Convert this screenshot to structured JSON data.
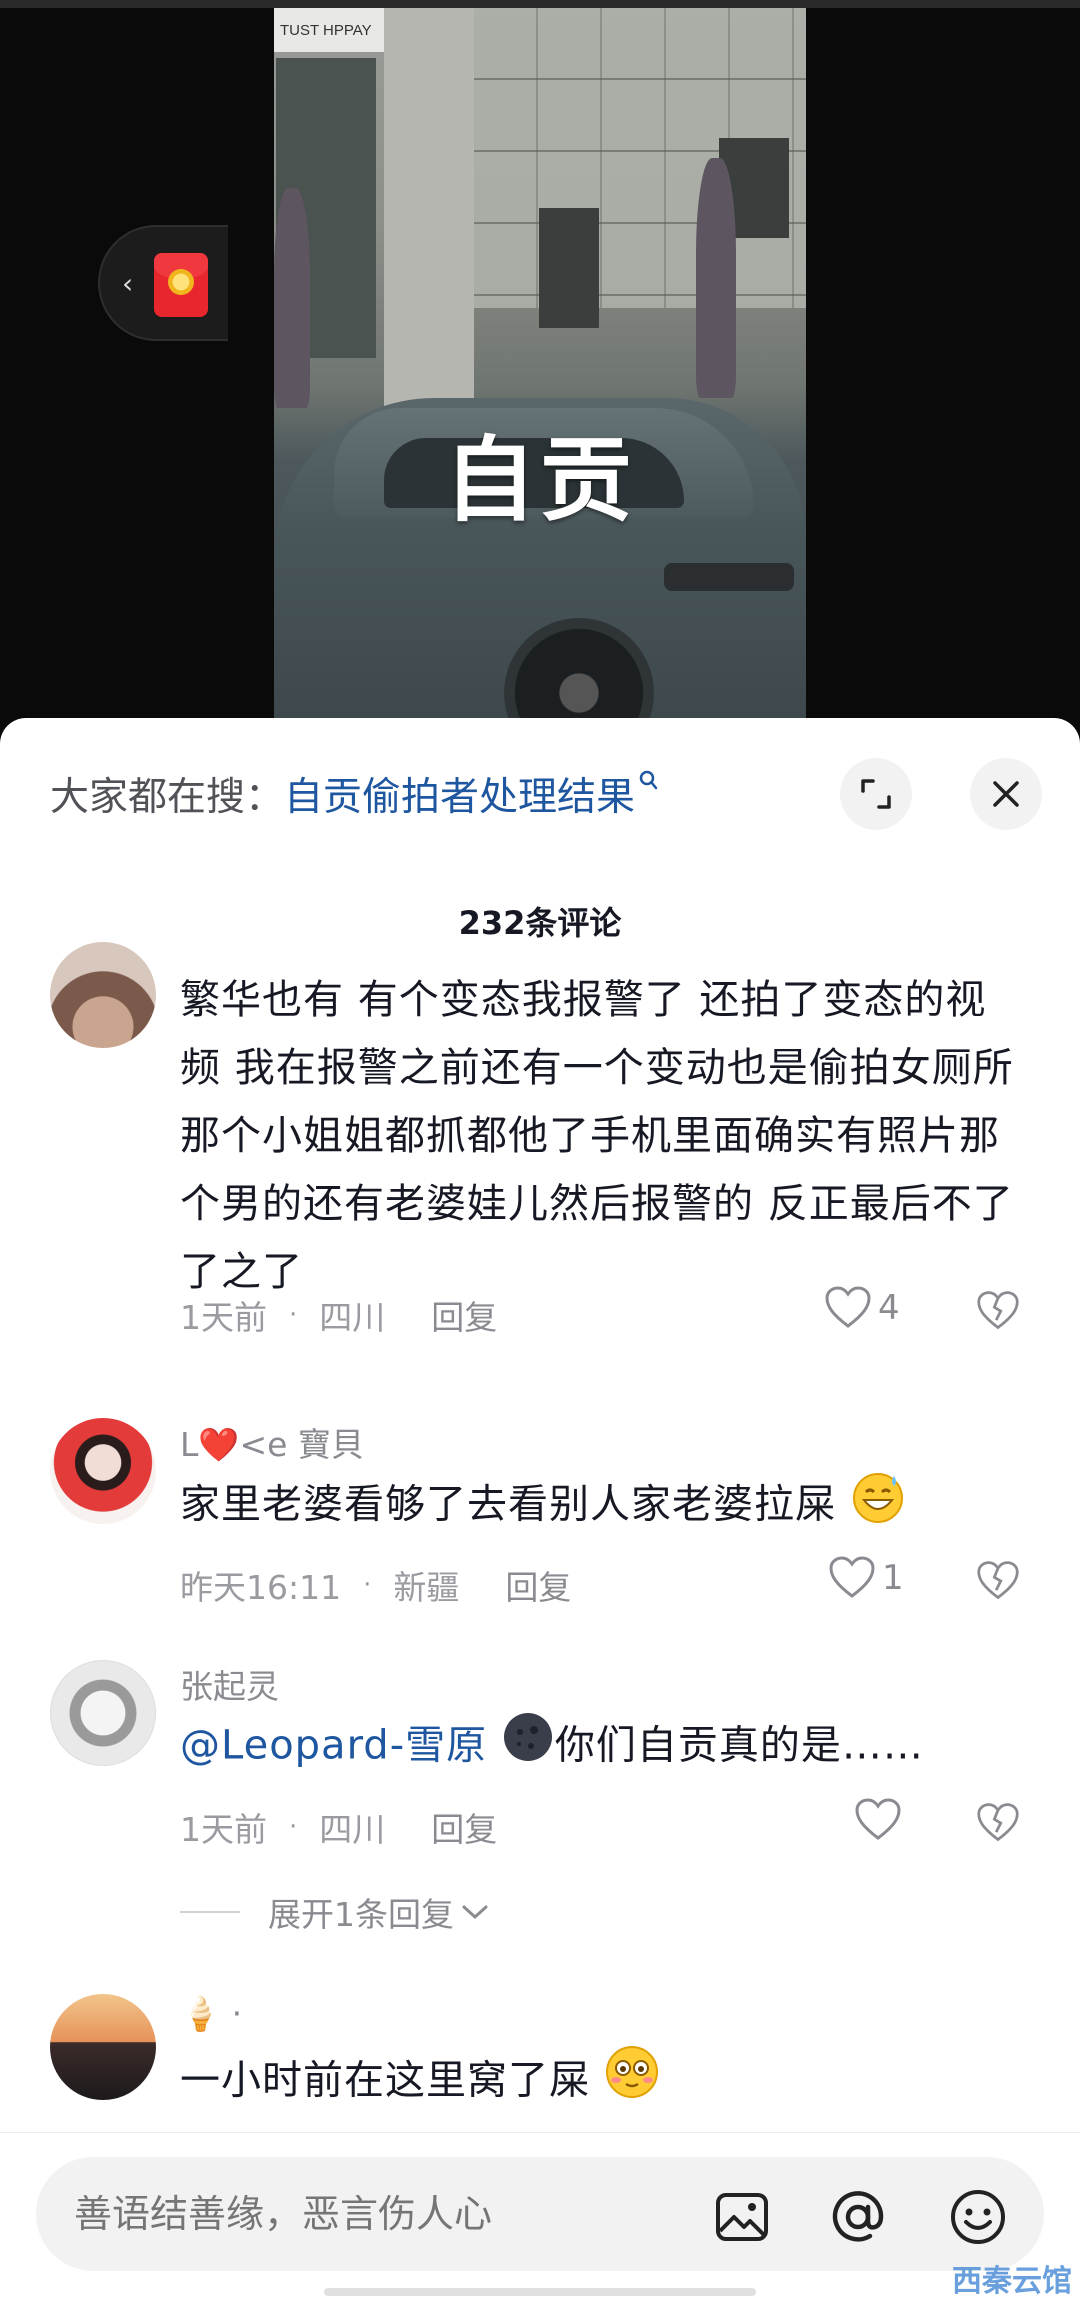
{
  "video": {
    "caption": "自贡",
    "shop_sign": "TUST HPPAY"
  },
  "search_bar": {
    "prefix": "大家都在搜：",
    "query": "自贡偷拍者处理结果"
  },
  "comments_header": {
    "count_label": "232条评论"
  },
  "comments": [
    {
      "username": "",
      "text": "繁华也有 有个变态我报警了 还拍了变态的视频  我在报警之前还有一个变动也是偷拍女厕所那个小姐姐都抓都他了手机里面确实有照片那个男的还有老婆娃儿然后报警的    反正最后不了了之了",
      "time": "1天前",
      "location": "四川",
      "reply_label": "回复",
      "likes": "4"
    },
    {
      "username": "L❤️<e 寶貝",
      "text": "家里老婆看够了去看别人家老婆拉屎",
      "time": "昨天16:11",
      "location": "新疆",
      "reply_label": "回复",
      "likes": "1"
    },
    {
      "username": "张起灵",
      "mention": "@Leopard-雪原",
      "text": "你们自贡真的是……",
      "time": "1天前",
      "location": "四川",
      "reply_label": "回复",
      "likes": "",
      "expand_label": "展开1条回复"
    },
    {
      "username": "🍦 ·",
      "text": "一小时前在这里窝了屎"
    }
  ],
  "input_bar": {
    "placeholder": "善语结善缘，恶言伤人心"
  },
  "watermark": "西秦云馆",
  "colors": {
    "link_blue": "#1e56a0",
    "meta_gray": "#9a9ba1",
    "redpacket": "#e8262d"
  }
}
